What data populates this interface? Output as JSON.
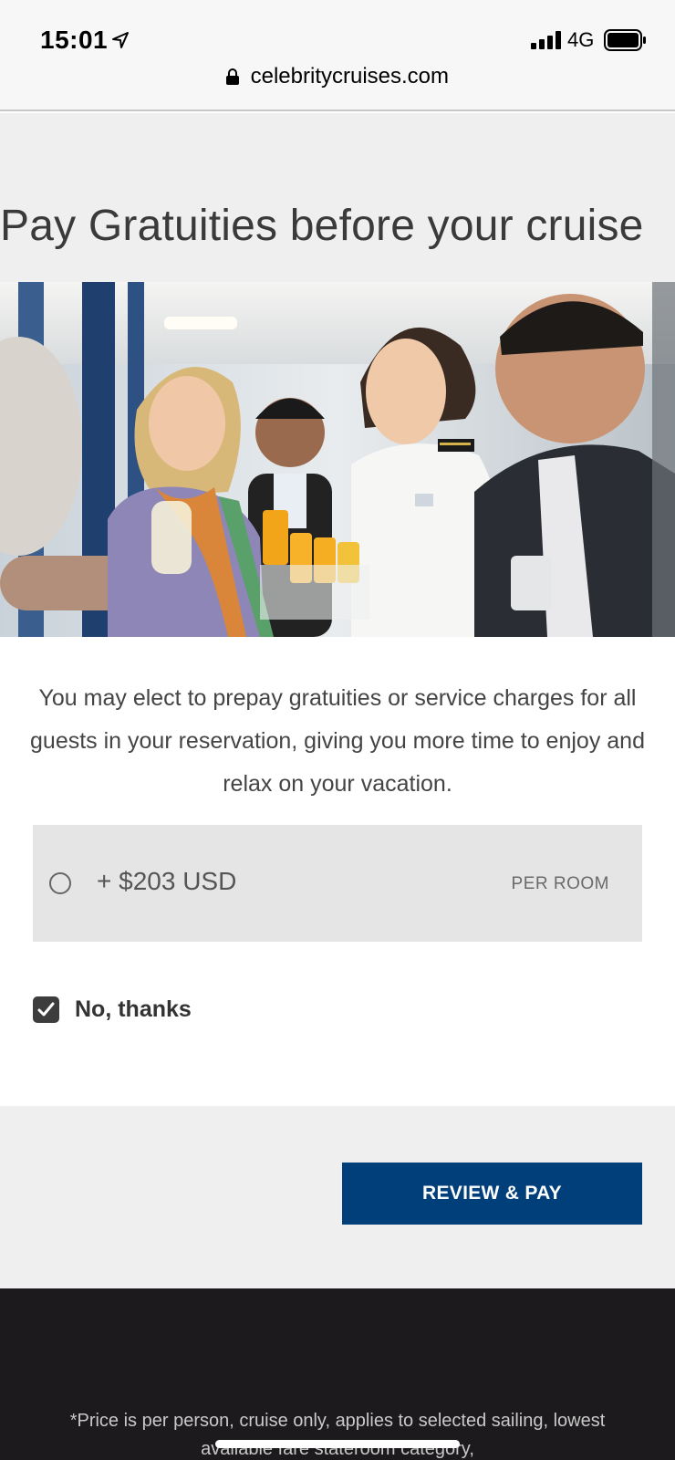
{
  "status_bar": {
    "time": "15:01",
    "network": "4G",
    "url": "celebritycruises.com"
  },
  "page": {
    "title": "Pay Gratuities before your cruise",
    "hero_alt": "Guests and crew toasting with drinks",
    "description": "You may elect to prepay gratuities or service charges for all guests in your reservation, giving you more time to enjoy and relax on your vacation."
  },
  "option": {
    "price": "+ $203 USD",
    "unit": "PER ROOM",
    "selected": false
  },
  "decline": {
    "label": "No, thanks",
    "checked": true
  },
  "actions": {
    "review_pay": "REVIEW & PAY"
  },
  "footer": {
    "note": "*Price is per person, cruise only, applies to selected sailing, lowest available fare stateroom category,"
  },
  "colors": {
    "primary_button": "#003f7a",
    "footer_bg": "#1c1a1c",
    "band_bg": "#efefef",
    "option_bg": "#e5e5e5"
  }
}
